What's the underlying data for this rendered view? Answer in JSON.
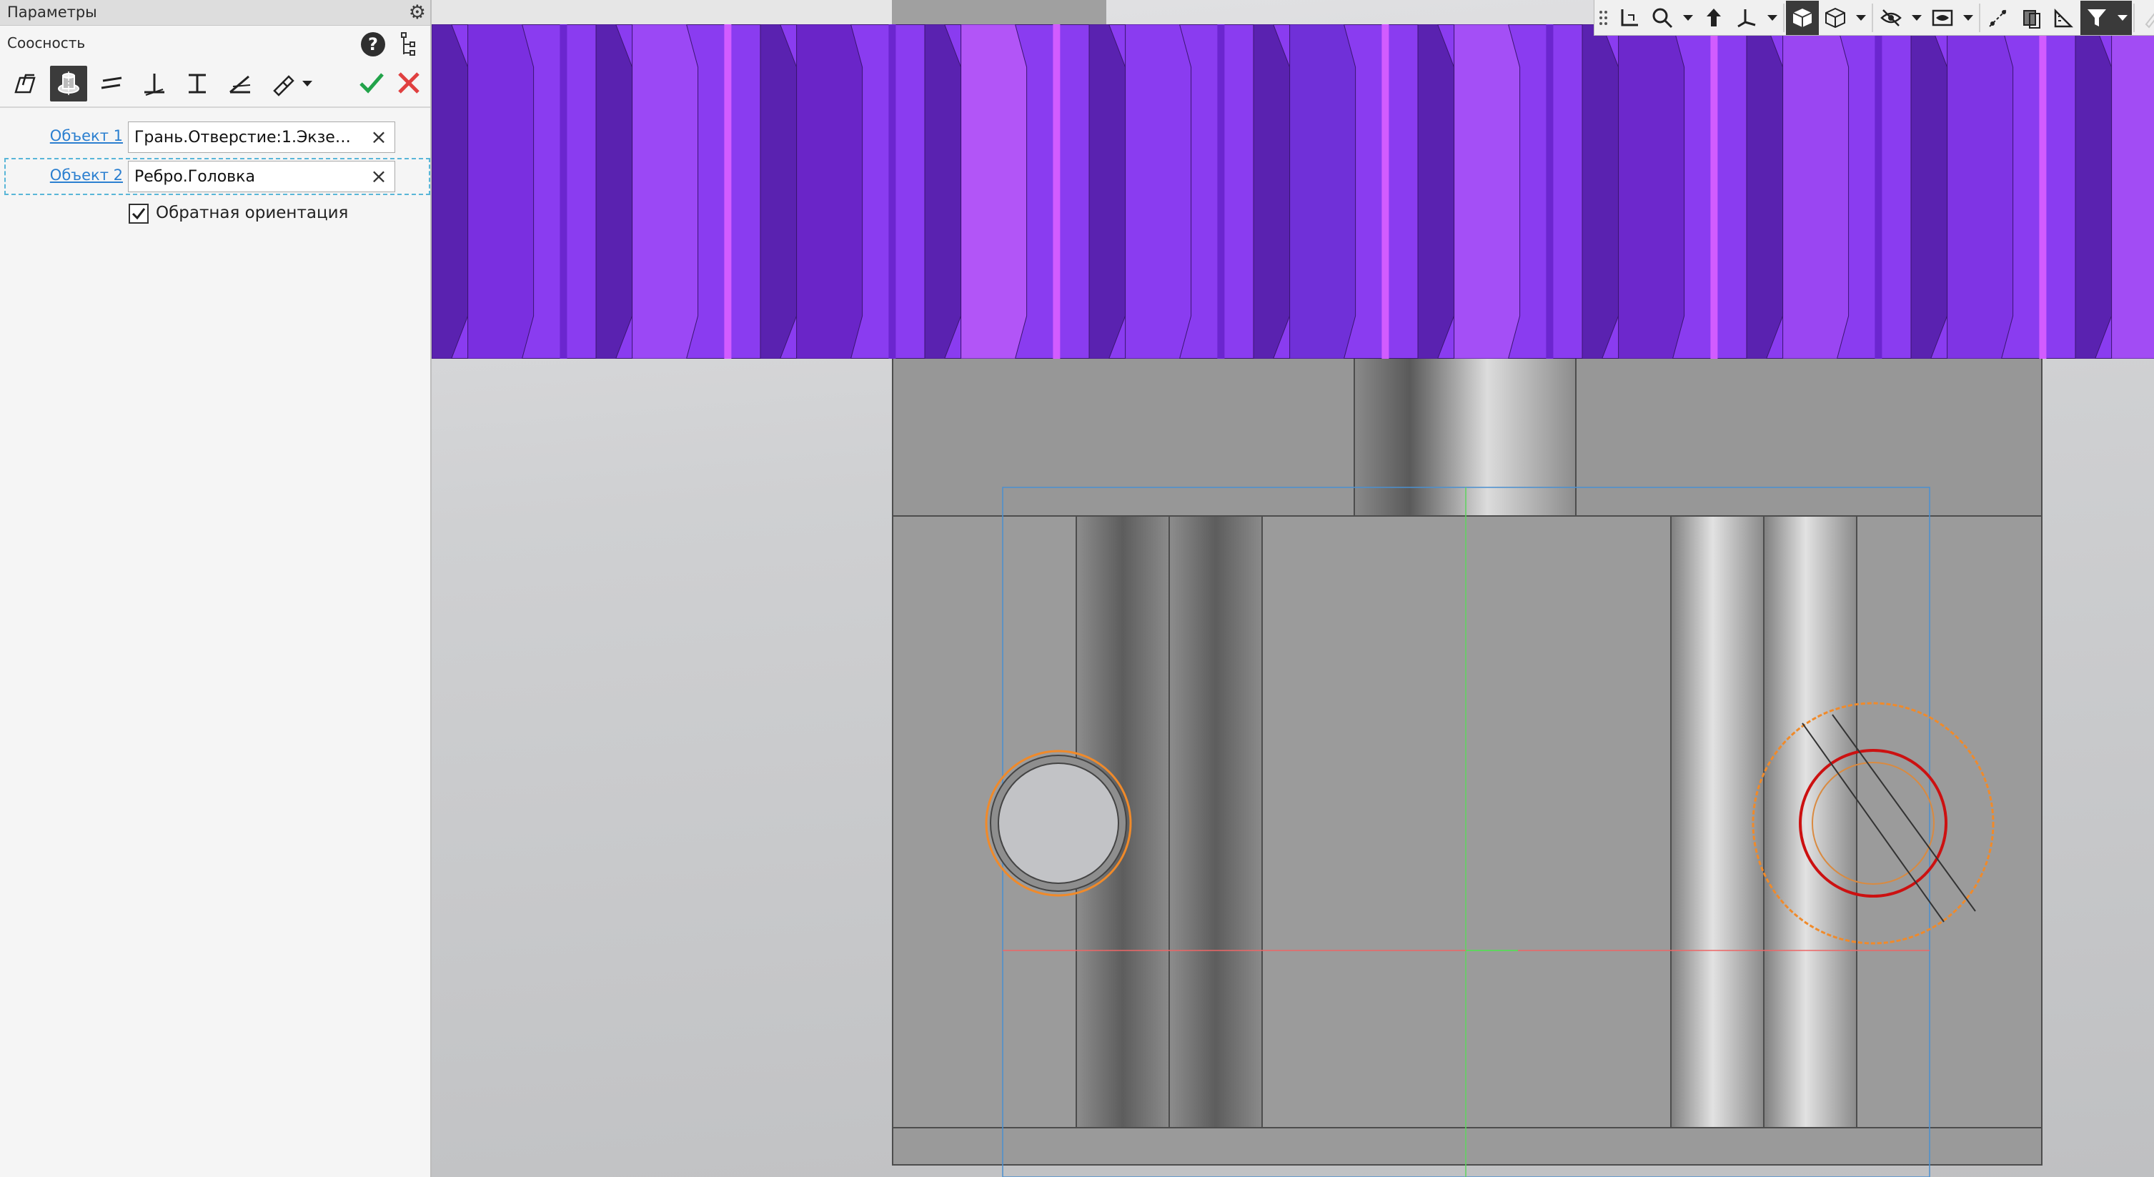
{
  "panel": {
    "title": "Параметры",
    "operation": "Соосность",
    "help_label": "?",
    "fields": [
      {
        "label": "Объект 1",
        "value": "Грань.Отверстие:1.Экземп..."
      },
      {
        "label": "Объект 2",
        "value": "Ребро.Головка"
      }
    ],
    "checkbox": {
      "label": "Обратная ориентация",
      "checked": true
    },
    "icons": [
      "coincidence-icon",
      "coaxial-icon",
      "parallel-icon",
      "perpendicular-icon",
      "tangent-icon",
      "angle-icon",
      "other-constraint-icon"
    ]
  },
  "viewport": {
    "toolbar_icons": [
      "grip-icon",
      "coordinate-system-icon",
      "zoom-icon",
      "orient-icon",
      "axis-icon",
      "shaded-view-icon",
      "wireframe-view-icon",
      "hide-icon",
      "visibility-icon",
      "snap-icon",
      "section-icon",
      "measure-icon",
      "filter-icon",
      "edit-icon",
      "ok-icon",
      "cancel-icon"
    ]
  },
  "colors": {
    "gear_violet": "#8a3cf0",
    "part_gray": "#9a9a9a",
    "confirm_green": "#22a34a",
    "cancel_red": "#e04040",
    "highlight_orange": "#f08a2a",
    "link_blue": "#2b7fd0"
  }
}
